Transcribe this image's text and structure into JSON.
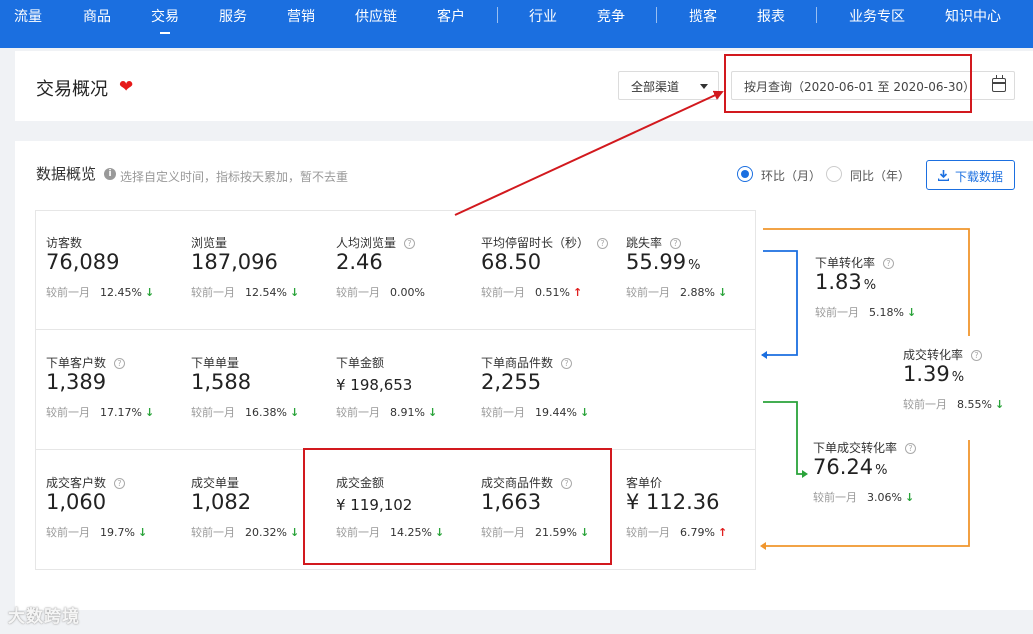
{
  "nav": {
    "items": [
      "流量",
      "商品",
      "交易",
      "服务",
      "营销",
      "供应链",
      "客户",
      "行业",
      "竞争",
      "揽客",
      "报表",
      "业务专区",
      "知识中心"
    ],
    "active": "交易"
  },
  "header": {
    "title": "交易概况",
    "channel": "全部渠道",
    "date_range": "按月查询（2020-06-01 至 2020-06-30）"
  },
  "overview": {
    "title": "数据概览",
    "hint": "选择自定义时间，指标按天累加，暂不去重",
    "radio_mom": "环比（月）",
    "radio_yoy": "同比（年）",
    "download": "下载数据",
    "compare_label": "较前一月"
  },
  "metrics": [
    {
      "label": "访客数",
      "value": "76,089",
      "change": "12.45%",
      "dir": "down",
      "help": false
    },
    {
      "label": "浏览量",
      "value": "187,096",
      "change": "12.54%",
      "dir": "down",
      "help": false
    },
    {
      "label": "人均浏览量",
      "value": "2.46",
      "change": "0.00%",
      "dir": "none",
      "help": true
    },
    {
      "label": "平均停留时长（秒）",
      "value": "68.50",
      "change": "0.51%",
      "dir": "up",
      "help": true
    },
    {
      "label": "跳失率",
      "value": "55.99",
      "unit": "%",
      "change": "2.88%",
      "dir": "down",
      "help": true
    },
    {
      "label": "下单客户数",
      "value": "1,389",
      "change": "17.17%",
      "dir": "down",
      "help": true
    },
    {
      "label": "下单单量",
      "value": "1,588",
      "change": "16.38%",
      "dir": "down",
      "help": false
    },
    {
      "label": "下单金额",
      "value": "¥ 198,653",
      "change": "8.91%",
      "dir": "down",
      "help": false,
      "money": true
    },
    {
      "label": "下单商品件数",
      "value": "2,255",
      "change": "19.44%",
      "dir": "down",
      "help": true
    },
    {
      "label": "成交客户数",
      "value": "1,060",
      "change": "19.7%",
      "dir": "down",
      "help": true
    },
    {
      "label": "成交单量",
      "value": "1,082",
      "change": "20.32%",
      "dir": "down",
      "help": false
    },
    {
      "label": "成交金额",
      "value": "¥ 119,102",
      "change": "14.25%",
      "dir": "down",
      "help": false,
      "money": true
    },
    {
      "label": "成交商品件数",
      "value": "1,663",
      "change": "21.59%",
      "dir": "down",
      "help": true
    },
    {
      "label": "客单价",
      "value": "¥ 112.36",
      "change": "6.79%",
      "dir": "up",
      "help": false
    }
  ],
  "conversions": [
    {
      "label": "下单转化率",
      "value": "1.83",
      "unit": "%",
      "change": "5.18%",
      "dir": "down"
    },
    {
      "label": "成交转化率",
      "value": "1.39",
      "unit": "%",
      "change": "8.55%",
      "dir": "down"
    },
    {
      "label": "下单成交转化率",
      "value": "76.24",
      "unit": "%",
      "change": "3.06%",
      "dir": "down"
    }
  ],
  "colors": {
    "nav": "#1b6fe0",
    "highlight": "#d2191e",
    "down": "#2aa33a",
    "up": "#e02020",
    "flow_blue": "#1b6fe0",
    "flow_green": "#2aa33a",
    "flow_orange": "#f0962d"
  },
  "watermark": "大数跨境"
}
